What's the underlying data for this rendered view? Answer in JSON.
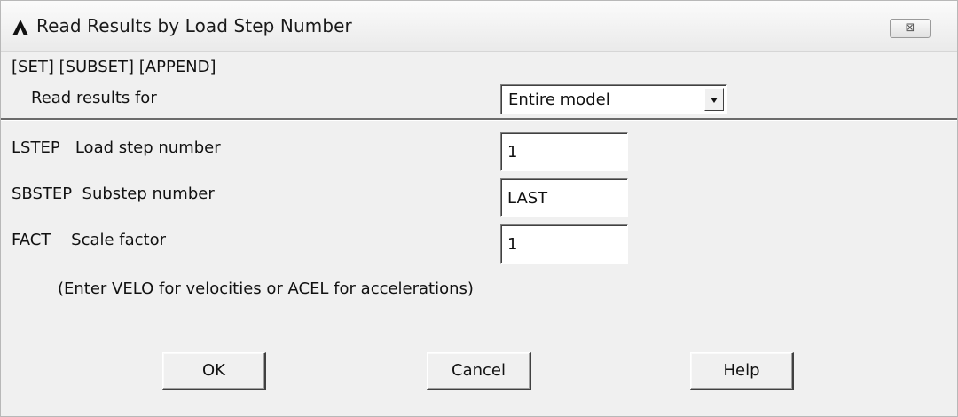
{
  "window": {
    "title": "Read Results by Load Step Number",
    "app_icon": "ansys-logo-icon",
    "close_icon": "close-icon",
    "close_glyph": "⊠"
  },
  "header": {
    "commands": "[SET] [SUBSET] [APPEND]",
    "read_results_label": "Read results for",
    "read_results_value": "Entire model"
  },
  "fields": {
    "lstep_label": "LSTEP   Load step number",
    "lstep_value": "1",
    "sbstep_label": "SBSTEP  Substep number",
    "sbstep_value": "LAST",
    "fact_label": "FACT    Scale factor",
    "fact_value": "1",
    "hint": "(Enter VELO for velocities or ACEL for accelerations)"
  },
  "buttons": {
    "ok": "OK",
    "cancel": "Cancel",
    "help": "Help"
  }
}
